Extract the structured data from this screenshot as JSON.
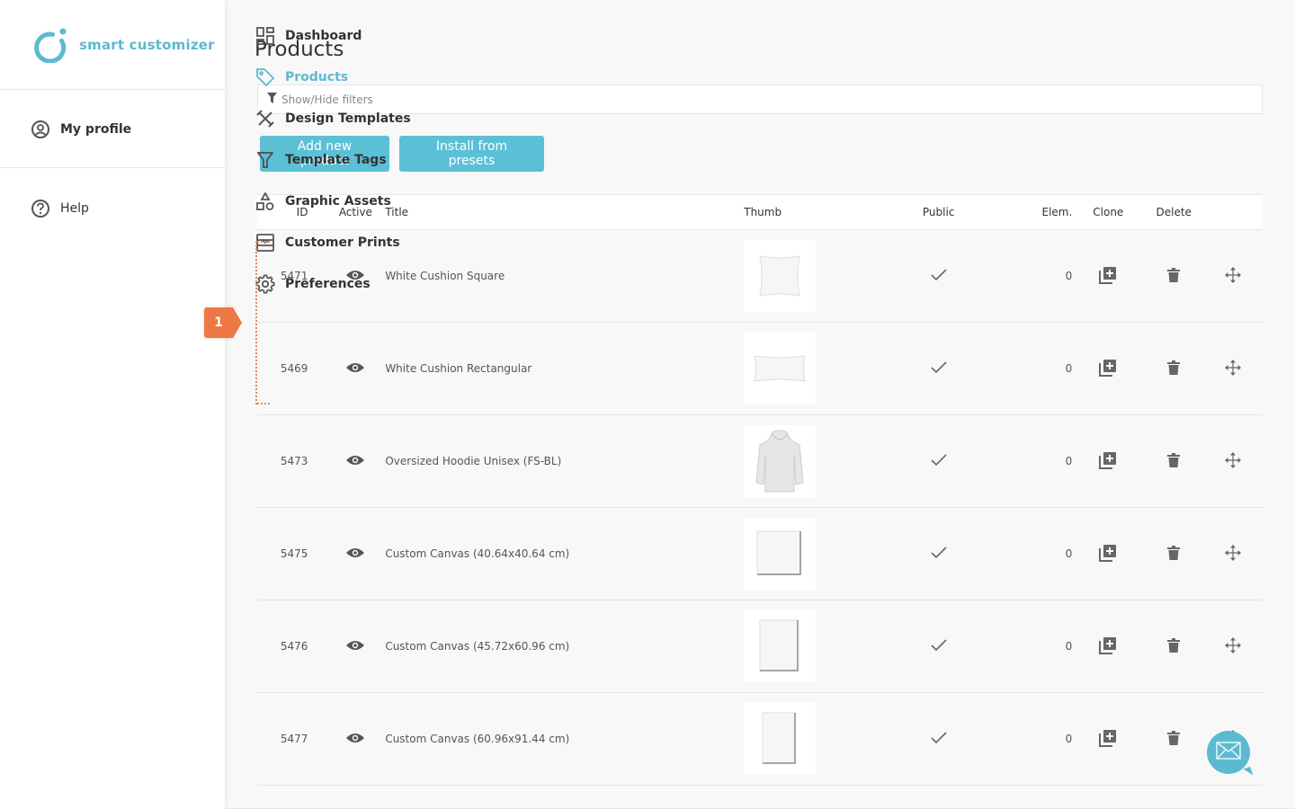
{
  "brand": {
    "name": "smart customizer",
    "accent": "#5bbad0"
  },
  "sidebar": {
    "profile": {
      "label": "My profile",
      "icon": "user-circle-icon"
    },
    "items": [
      {
        "label": "Dashboard",
        "icon": "dashboard-icon",
        "active": false
      },
      {
        "label": "Products",
        "icon": "tag-icon",
        "active": true
      },
      {
        "label": "Design Templates",
        "icon": "design-tools-icon",
        "active": false
      },
      {
        "label": "Template Tags",
        "icon": "filter-icon",
        "active": false
      },
      {
        "label": "Graphic Assets",
        "icon": "shapes-icon",
        "active": false
      },
      {
        "label": "Customer Prints",
        "icon": "prints-icon",
        "active": false
      },
      {
        "label": "Preferences",
        "icon": "gear-icon",
        "active": false
      }
    ],
    "help": {
      "label": "Help",
      "icon": "help-circle-icon"
    }
  },
  "step_badge": {
    "number": "1",
    "color": "#ee7746"
  },
  "main": {
    "title": "Products",
    "filter_toggle": "Show/Hide filters",
    "buttons": {
      "add_new": "Add new product",
      "install_presets": "Install from presets"
    },
    "table": {
      "headers": {
        "id": "ID",
        "active": "Active",
        "title": "Title",
        "thumb": "Thumb",
        "public": "Public",
        "elem": "Elem.",
        "clone": "Clone",
        "delete": "Delete"
      },
      "rows": [
        {
          "id": "5471",
          "title": "White Cushion Square",
          "thumb": "cushion-square",
          "active": true,
          "public": true,
          "elem": "0"
        },
        {
          "id": "5469",
          "title": "White Cushion Rectangular",
          "thumb": "cushion-rect",
          "active": true,
          "public": true,
          "elem": "0"
        },
        {
          "id": "5473",
          "title": "Oversized Hoodie Unisex (FS-BL)",
          "thumb": "hoodie",
          "active": true,
          "public": true,
          "elem": "0"
        },
        {
          "id": "5475",
          "title": "Custom Canvas (40.64x40.64 cm)",
          "thumb": "canvas-square",
          "active": true,
          "public": true,
          "elem": "0"
        },
        {
          "id": "5476",
          "title": "Custom Canvas (45.72x60.96 cm)",
          "thumb": "canvas-portrait",
          "active": true,
          "public": true,
          "elem": "0"
        },
        {
          "id": "5477",
          "title": "Custom Canvas (60.96x91.44 cm)",
          "thumb": "canvas-tall",
          "active": true,
          "public": true,
          "elem": "0"
        }
      ]
    }
  },
  "chat": {
    "icon": "mail-icon"
  }
}
